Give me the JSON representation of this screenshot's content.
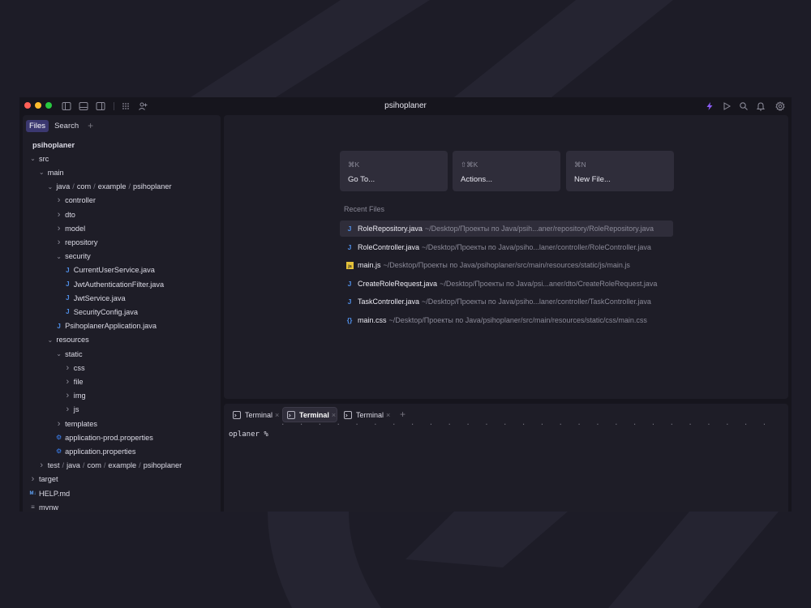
{
  "window": {
    "title": "psihoplaner",
    "traffic_colors": [
      "#ff5f57",
      "#febc2e",
      "#28c840"
    ],
    "accent": "#8b5cf6"
  },
  "titlebar_icons": [
    "sidebar-left-icon",
    "panel-bottom-icon",
    "sidebar-right-icon",
    "grid-icon",
    "add-user-icon",
    "bolt-icon",
    "play-icon",
    "search-icon",
    "bell-icon",
    "gear-icon"
  ],
  "sidebar": {
    "tabs": [
      {
        "label": "Files",
        "active": true
      },
      {
        "label": "Search",
        "active": false
      }
    ],
    "tab_add": "+",
    "tree": [
      {
        "label": "psihoplaner",
        "depth": 0,
        "kind": "root"
      },
      {
        "label": "src",
        "depth": 0,
        "kind": "open"
      },
      {
        "label": "main",
        "depth": 1,
        "kind": "open"
      },
      {
        "label": "java / com / example / psihoplaner",
        "depth": 2,
        "kind": "open"
      },
      {
        "label": "controller",
        "depth": 3,
        "kind": "closed"
      },
      {
        "label": "dto",
        "depth": 3,
        "kind": "closed"
      },
      {
        "label": "model",
        "depth": 3,
        "kind": "closed"
      },
      {
        "label": "repository",
        "depth": 3,
        "kind": "closed"
      },
      {
        "label": "security",
        "depth": 3,
        "kind": "open"
      },
      {
        "label": "CurrentUserService.java",
        "depth": 4,
        "kind": "java"
      },
      {
        "label": "JwtAuthenticationFilter.java",
        "depth": 4,
        "kind": "java"
      },
      {
        "label": "JwtService.java",
        "depth": 4,
        "kind": "java"
      },
      {
        "label": "SecurityConfig.java",
        "depth": 4,
        "kind": "java"
      },
      {
        "label": "PsihoplanerApplication.java",
        "depth": 3,
        "kind": "java"
      },
      {
        "label": "resources",
        "depth": 2,
        "kind": "open"
      },
      {
        "label": "static",
        "depth": 3,
        "kind": "open"
      },
      {
        "label": "css",
        "depth": 4,
        "kind": "closed"
      },
      {
        "label": "file",
        "depth": 4,
        "kind": "closed"
      },
      {
        "label": "img",
        "depth": 4,
        "kind": "closed"
      },
      {
        "label": "js",
        "depth": 4,
        "kind": "closed"
      },
      {
        "label": "templates",
        "depth": 3,
        "kind": "closed"
      },
      {
        "label": "application-prod.properties",
        "depth": 3,
        "kind": "props"
      },
      {
        "label": "application.properties",
        "depth": 3,
        "kind": "props"
      },
      {
        "label": "test / java / com / example / psihoplaner",
        "depth": 1,
        "kind": "closed"
      },
      {
        "label": "target",
        "depth": 0,
        "kind": "closed"
      },
      {
        "label": "HELP.md",
        "depth": 0,
        "kind": "md"
      },
      {
        "label": "mvnw",
        "depth": 0,
        "kind": "text"
      }
    ]
  },
  "quick_actions": [
    {
      "shortcut": "⌘K",
      "label": "Go To..."
    },
    {
      "shortcut": "⇧⌘K",
      "label": "Actions..."
    },
    {
      "shortcut": "⌘N",
      "label": "New File..."
    }
  ],
  "recent": {
    "title": "Recent Files",
    "files": [
      {
        "name": "RoleRepository.java",
        "path": "~/Desktop/Проекты по Java/psih...aner/repository/RoleRepository.java",
        "kind": "java",
        "selected": true
      },
      {
        "name": "RoleController.java",
        "path": "~/Desktop/Проекты по Java/psiho...laner/controller/RoleController.java",
        "kind": "java",
        "selected": false
      },
      {
        "name": "main.js",
        "path": "~/Desktop/Проекты по Java/psihoplaner/src/main/resources/static/js/main.js",
        "kind": "js",
        "selected": false
      },
      {
        "name": "CreateRoleRequest.java",
        "path": "~/Desktop/Проекты по Java/psi...aner/dto/CreateRoleRequest.java",
        "kind": "java",
        "selected": false
      },
      {
        "name": "TaskController.java",
        "path": "~/Desktop/Проекты по Java/psiho...laner/controller/TaskController.java",
        "kind": "java",
        "selected": false
      },
      {
        "name": "main.css",
        "path": "~/Desktop/Проекты по Java/psihoplaner/src/main/resources/static/css/main.css",
        "kind": "css",
        "selected": false
      }
    ]
  },
  "terminal": {
    "tabs": [
      {
        "label": "Terminal",
        "active": false
      },
      {
        "label": "Terminal",
        "active": true
      },
      {
        "label": "Terminal",
        "active": false
      }
    ],
    "close": "×",
    "add": "+",
    "prompt": "oplaner %"
  }
}
